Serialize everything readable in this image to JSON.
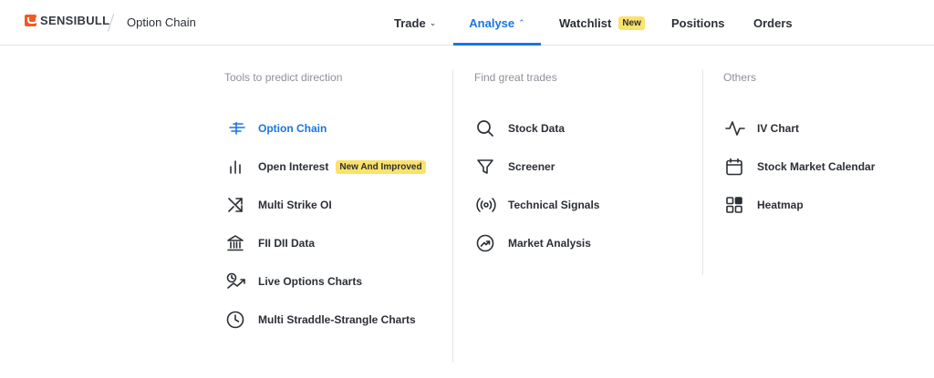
{
  "brand": {
    "name": "SENSIBULL",
    "color": "#f15a24"
  },
  "breadcrumb": {
    "page": "Option Chain"
  },
  "nav": {
    "trade": "Trade",
    "analyse": "Analyse",
    "watchlist": "Watchlist",
    "watchlist_badge": "New",
    "positions": "Positions",
    "orders": "Orders",
    "active": "Analyse",
    "accent": "#1b74e4"
  },
  "menu": {
    "col1": {
      "title": "Tools to predict direction",
      "items": [
        {
          "label": "Option Chain",
          "icon": "option-chain-icon",
          "active": true
        },
        {
          "label": "Open Interest",
          "icon": "bar-chart-icon",
          "badge": "New And Improved"
        },
        {
          "label": "Multi Strike OI",
          "icon": "shuffle-icon"
        },
        {
          "label": "FII DII Data",
          "icon": "bank-icon"
        },
        {
          "label": "Live Options Charts",
          "icon": "trend-chart-icon"
        },
        {
          "label": "Multi Straddle-Strangle Charts",
          "icon": "clock-icon"
        }
      ]
    },
    "col2": {
      "title": "Find great trades",
      "items": [
        {
          "label": "Stock Data",
          "icon": "search-icon"
        },
        {
          "label": "Screener",
          "icon": "filter-icon"
        },
        {
          "label": "Technical Signals",
          "icon": "broadcast-icon"
        },
        {
          "label": "Market Analysis",
          "icon": "trend-circle-icon"
        }
      ]
    },
    "col3": {
      "title": "Others",
      "items": [
        {
          "label": "IV Chart",
          "icon": "pulse-icon"
        },
        {
          "label": "Stock Market Calendar",
          "icon": "calendar-icon"
        },
        {
          "label": "Heatmap",
          "icon": "grid-icon"
        }
      ]
    }
  }
}
